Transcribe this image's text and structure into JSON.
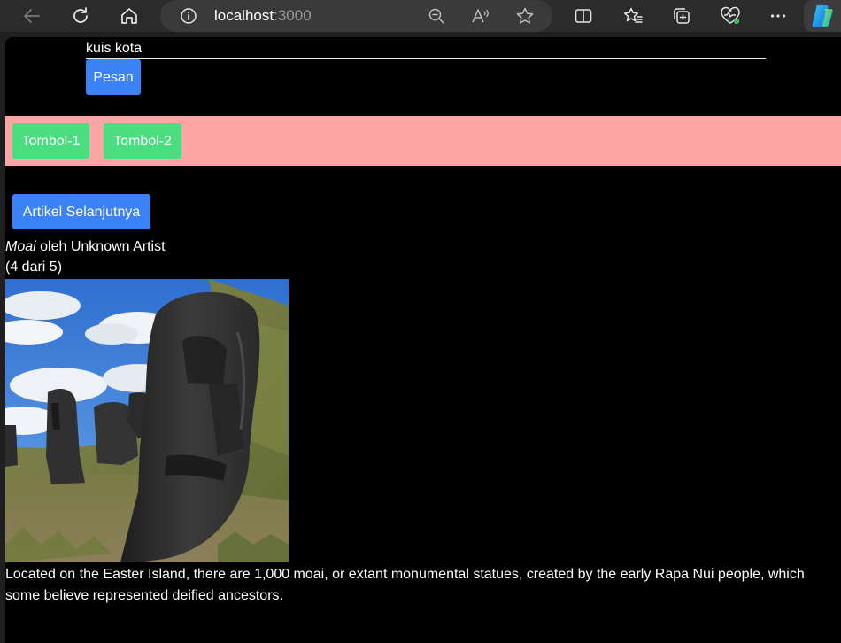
{
  "browser": {
    "url_host": "localhost",
    "url_port": ":3000",
    "icons": [
      "back-icon",
      "refresh-icon",
      "home-icon",
      "site-info-icon",
      "zoom-out-icon",
      "read-aloud-icon",
      "favorite-star-icon",
      "split-screen-icon",
      "favorites-icon",
      "collections-icon",
      "browser-essentials-icon",
      "more-icon",
      "copilot-icon"
    ]
  },
  "page": {
    "quiz_label": "kuis kota",
    "message_button": "Pesan",
    "toolbar_buttons": [
      "Tombol-1",
      "Tombol-2"
    ],
    "next_article_button": "Artikel Selanjutnya",
    "artwork": {
      "title": "Moai",
      "byline": "oleh Unknown Artist",
      "position": "(4 dari 5)",
      "description": "Located on the Easter Island, there are 1,000 moai, or extant monumental statues, created by the early Rapa Nui people, which some believe represented deified ancestors."
    }
  },
  "colors": {
    "page_background": "#000000",
    "button_blue": "#3b82f6",
    "button_green": "#4ade80",
    "toolbar_band": "#fca5a5"
  }
}
